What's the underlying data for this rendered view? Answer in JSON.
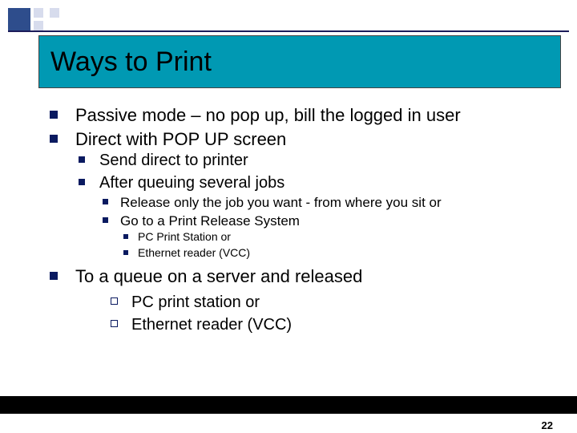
{
  "title": "Ways to Print",
  "bullets": {
    "l1": [
      "Passive mode – no pop up, bill the logged in user",
      "Direct with POP UP screen"
    ],
    "l2a": [
      "Send direct to printer",
      "After queuing several jobs"
    ],
    "l3a": [
      "Release only the job you want - from where you sit or",
      "Go to a Print Release System"
    ],
    "l4a": [
      "PC Print Station or",
      "Ethernet reader (VCC)"
    ],
    "l1b": [
      "To a queue on a server and released"
    ],
    "l2b": [
      "PC print station or",
      "Ethernet reader (VCC)"
    ]
  },
  "page_number": "22"
}
